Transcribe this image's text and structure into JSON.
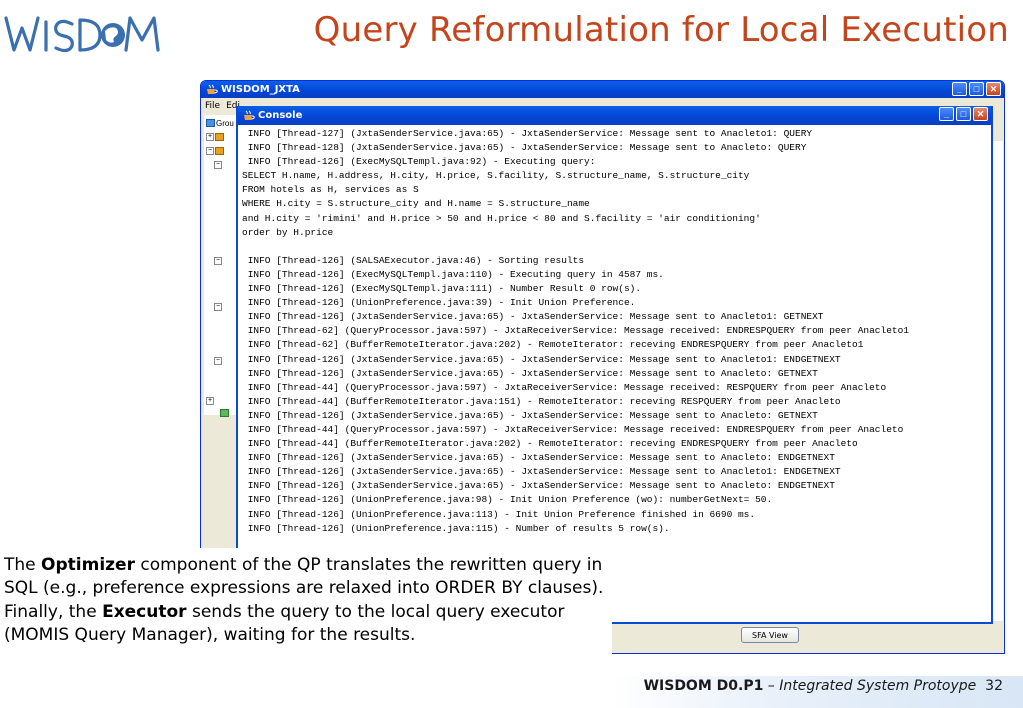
{
  "slide": {
    "title": "Query Reformulation for Local Execution",
    "logo_text": "WISDOM",
    "footer": {
      "project": "WISDOM D0.P1",
      "sep": " – ",
      "subtitle": "Integrated System Protoype",
      "page": "32"
    },
    "paragraph": {
      "p1_pre": "The ",
      "p1_bold": "Optimizer",
      "p1_post": " component of the QP translates the rewritten query in SQL (e.g., preference expressions are relaxed into ORDER BY clauses).",
      "p2_pre": "Finally, the ",
      "p2_bold": "Executor",
      "p2_post": " sends the query to the local query executor (MOMIS Query Manager), waiting for the results."
    }
  },
  "jxta_window": {
    "title": "WISDOM_JXTA",
    "menu": [
      "File",
      "Edi"
    ],
    "tree_label": "Grou",
    "sfa_button": "SFA View"
  },
  "console_window": {
    "title": "Console",
    "lines": [
      " INFO [Thread-127] (JxtaSenderService.java:65) - JxtaSenderService: Message sent to Anacleto1: QUERY",
      " INFO [Thread-128] (JxtaSenderService.java:65) - JxtaSenderService: Message sent to Anacleto: QUERY",
      " INFO [Thread-126] (ExecMySQLTempl.java:92) - Executing query:",
      "SELECT H.name, H.address, H.city, H.price, S.facility, S.structure_name, S.structure_city",
      "FROM hotels as H, services as S",
      "WHERE H.city = S.structure_city and H.name = S.structure_name",
      "and H.city = 'rimini' and H.price > 50 and H.price < 80 and S.facility = 'air conditioning'",
      "order by H.price",
      "",
      " INFO [Thread-126] (SALSAExecutor.java:46) - Sorting results",
      " INFO [Thread-126] (ExecMySQLTempl.java:110) - Executing query in 4587 ms.",
      " INFO [Thread-126] (ExecMySQLTempl.java:111) - Number Result 0 row(s).",
      " INFO [Thread-126] (UnionPreference.java:39) - Init Union Preference.",
      " INFO [Thread-126] (JxtaSenderService.java:65) - JxtaSenderService: Message sent to Anacleto1: GETNEXT",
      " INFO [Thread-62] (QueryProcessor.java:597) - JxtaReceiverService: Message received: ENDRESPQUERY from peer Anacleto1",
      " INFO [Thread-62] (BufferRemoteIterator.java:202) - RemoteIterator: receving ENDRESPQUERY from peer Anacleto1",
      " INFO [Thread-126] (JxtaSenderService.java:65) - JxtaSenderService: Message sent to Anacleto1: ENDGETNEXT",
      " INFO [Thread-126] (JxtaSenderService.java:65) - JxtaSenderService: Message sent to Anacleto: GETNEXT",
      " INFO [Thread-44] (QueryProcessor.java:597) - JxtaReceiverService: Message received: RESPQUERY from peer Anacleto",
      " INFO [Thread-44] (BufferRemoteIterator.java:151) - RemoteIterator: receving RESPQUERY from peer Anacleto",
      " INFO [Thread-126] (JxtaSenderService.java:65) - JxtaSenderService: Message sent to Anacleto: GETNEXT",
      " INFO [Thread-44] (QueryProcessor.java:597) - JxtaReceiverService: Message received: ENDRESPQUERY from peer Anacleto",
      " INFO [Thread-44] (BufferRemoteIterator.java:202) - RemoteIterator: receving ENDRESPQUERY from peer Anacleto",
      " INFO [Thread-126] (JxtaSenderService.java:65) - JxtaSenderService: Message sent to Anacleto: ENDGETNEXT",
      " INFO [Thread-126] (JxtaSenderService.java:65) - JxtaSenderService: Message sent to Anacleto1: ENDGETNEXT",
      " INFO [Thread-126] (JxtaSenderService.java:65) - JxtaSenderService: Message sent to Anacleto: ENDGETNEXT",
      " INFO [Thread-126] (UnionPreference.java:98) - Init Union Preference (wo): numberGetNext= 50.",
      " INFO [Thread-126] (UnionPreference.java:113) - Init Union Preference finished in 6690 ms.",
      " INFO [Thread-126] (UnionPreference.java:115) - Number of results 5 row(s)."
    ]
  },
  "colors": {
    "title_color": "#c4441b",
    "logo_color": "#3a6fb0",
    "xp_blue": "#0545d6"
  },
  "icons": [
    "wisdom-logo",
    "java-cup-icon",
    "minimize-icon",
    "maximize-icon",
    "close-icon"
  ]
}
